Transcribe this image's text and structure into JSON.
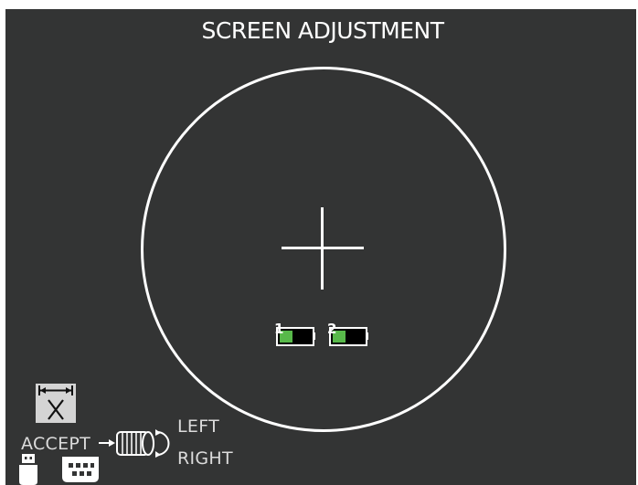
{
  "screen": {
    "title": "SCREEN ADJUSTMENT"
  },
  "batteries": [
    {
      "number": "1",
      "level": 0.4
    },
    {
      "number": "2",
      "level": 0.4
    }
  ],
  "controls": {
    "accept_label": "ACCEPT",
    "left_label": "LEFT",
    "right_label": "RIGHT"
  },
  "icons": {
    "horizontal_adjust": "horizontal-width-icon",
    "rotary_knob": "rotary-knob-icon",
    "usb": "usb-icon",
    "keyboard": "keyboard-icon"
  },
  "colors": {
    "background": "#333434",
    "foreground": "#ffffff",
    "battery_fill": "#58b94a"
  }
}
